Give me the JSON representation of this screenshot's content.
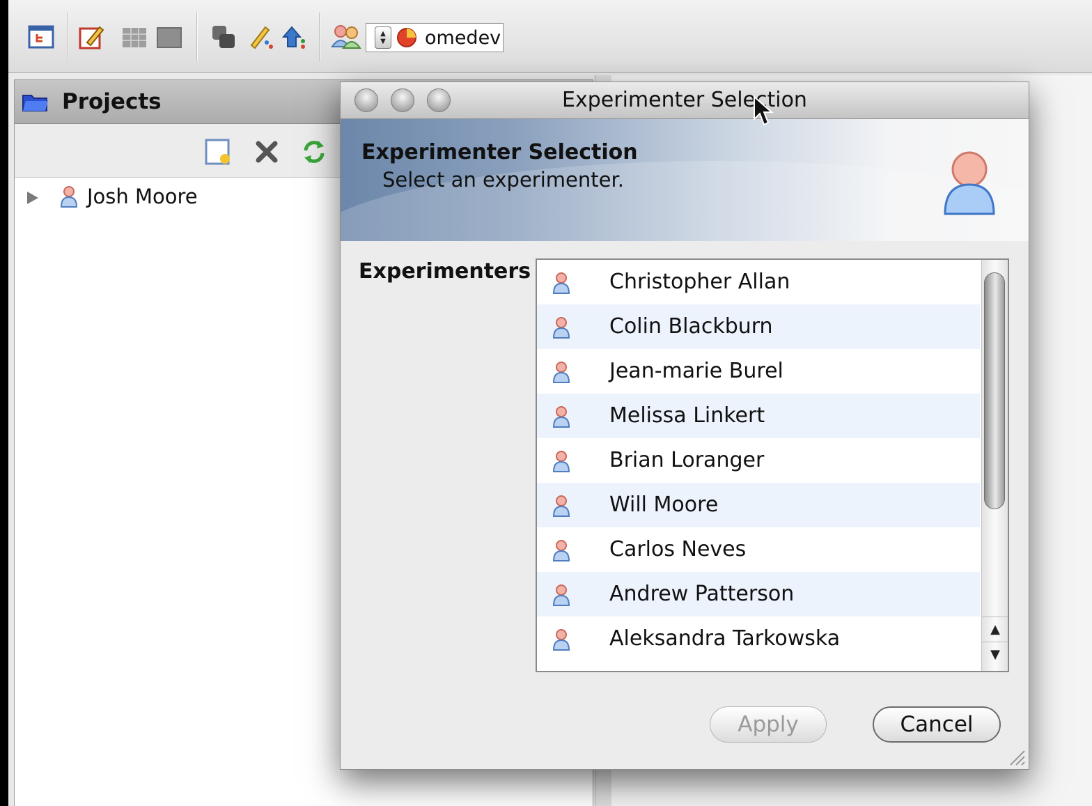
{
  "toolbar": {
    "icons": [
      "hierarchy-icon",
      "annotate-icon",
      "grid-view-icon",
      "single-view-icon",
      "search-icon",
      "pen-tools-icon",
      "tag-icon",
      "users-icon"
    ],
    "server_label": "omedev"
  },
  "projects_panel": {
    "title": "Projects",
    "actions": [
      "new-item-icon",
      "delete-icon",
      "refresh-icon"
    ],
    "tree": [
      {
        "label": "Josh Moore",
        "expanded": false
      }
    ]
  },
  "dialog": {
    "title": "Experimenter Selection",
    "banner_title": "Experimenter Selection",
    "banner_subtitle": "Select an experimenter.",
    "list_label": "Experimenters",
    "experimenters": [
      "Christopher Allan",
      "Colin Blackburn",
      "Jean-marie Burel",
      "Melissa Linkert",
      "Brian Loranger",
      "Will Moore",
      "Carlos Neves",
      "Andrew Patterson",
      "Aleksandra Tarkowska"
    ],
    "apply_label": "Apply",
    "apply_enabled": false,
    "cancel_label": "Cancel"
  },
  "colors": {
    "banner_start": "#6c87aa",
    "row_alternate": "#edf3fd",
    "person_icon": "#e89a8a"
  }
}
